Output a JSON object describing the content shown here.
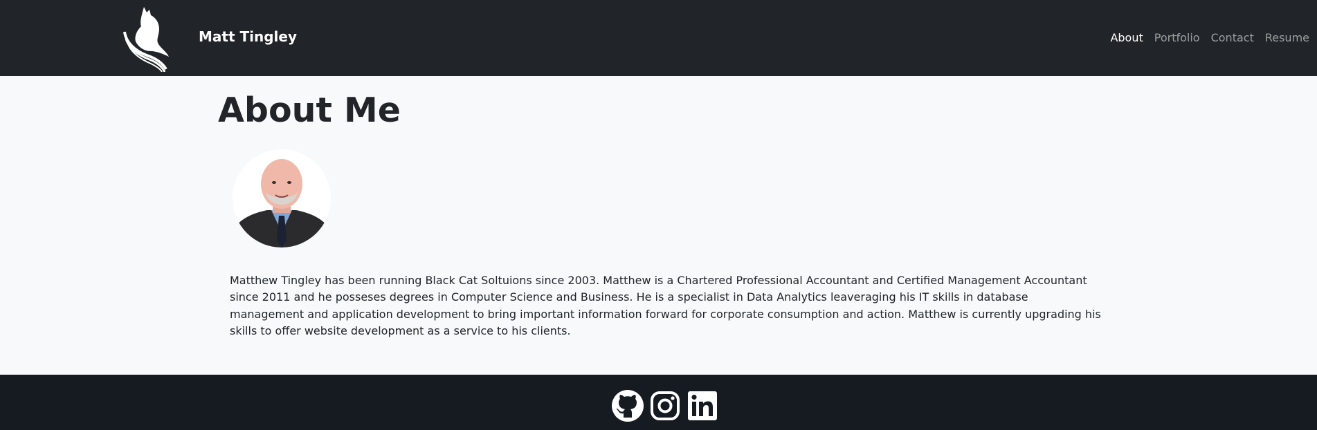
{
  "header": {
    "brand_name": "Matt Tingley",
    "logo_icon": "black-cat-logo-icon",
    "nav": [
      {
        "label": "About",
        "active": true
      },
      {
        "label": "Portfolio",
        "active": false
      },
      {
        "label": "Contact",
        "active": false
      },
      {
        "label": "Resume",
        "active": false
      }
    ]
  },
  "main": {
    "title": "About Me",
    "bio": "Matthew Tingley has been running Black Cat Soltuions since 2003. Matthew is a Chartered Professional Accountant and Certified Management Accountant since 2011 and he posseses degrees in Computer Science and Business. He is a specialist in Data Analytics leaveraging his IT skills in database management and application development to bring important information forward for corporate consumption and action. Matthew is currently upgrading his skills to offer website development as a service to his clients."
  },
  "footer": {
    "social": [
      {
        "icon": "github-icon"
      },
      {
        "icon": "instagram-icon"
      },
      {
        "icon": "linkedin-icon"
      }
    ]
  },
  "colors": {
    "navbar_bg": "#212529",
    "page_bg": "#f8f9fa",
    "footer_bg": "#161b22",
    "text": "#212529"
  }
}
